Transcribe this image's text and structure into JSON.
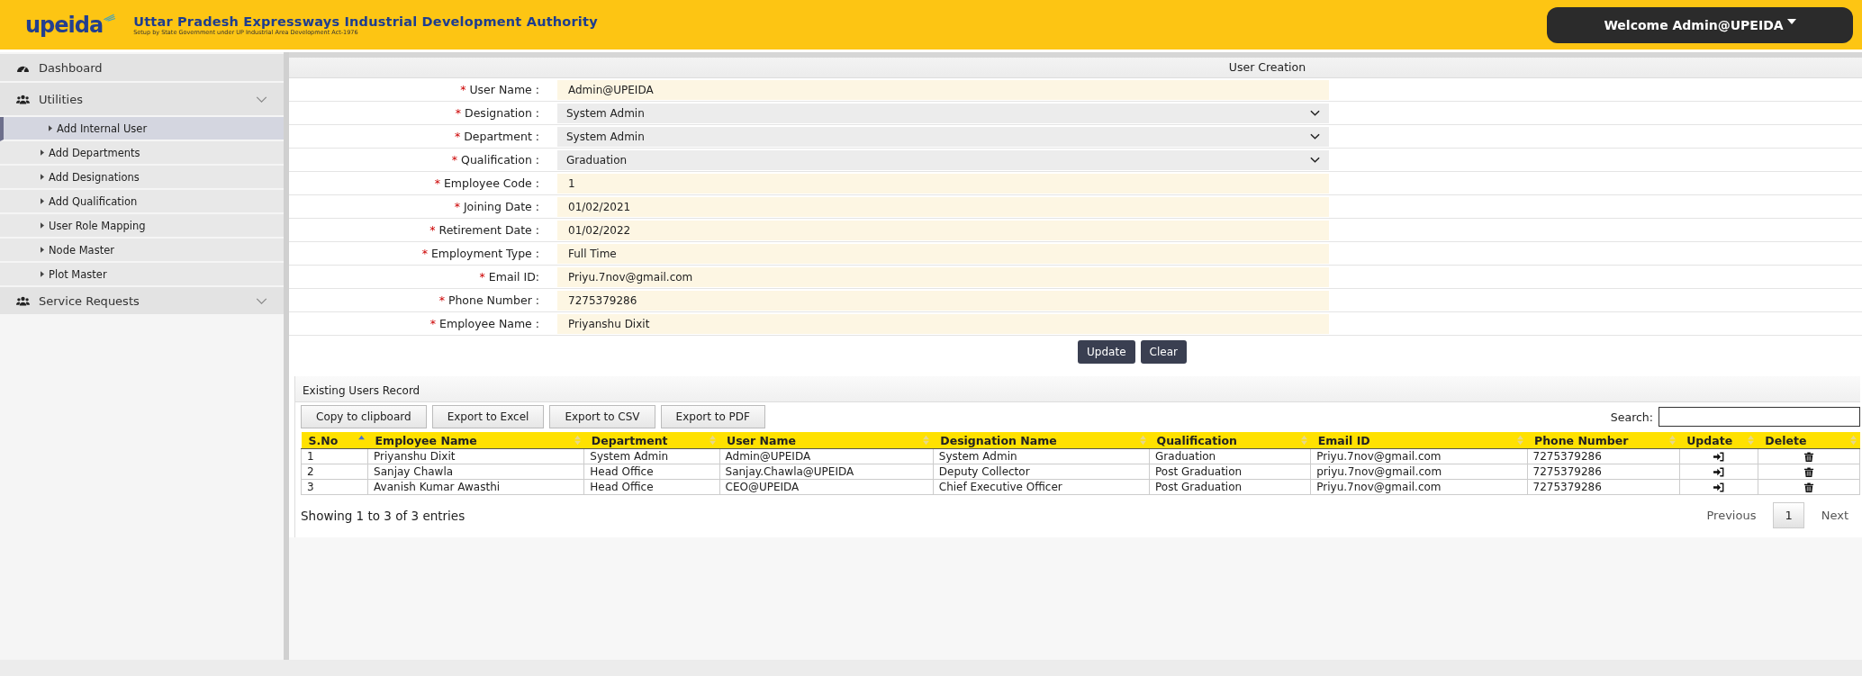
{
  "header": {
    "logo_text": "upeida",
    "title": "Uttar Pradesh Expressways Industrial Development Authority",
    "subtitle": "Setup by State Government under UP Industrial Area Development Act-1976",
    "user_menu": "Welcome Admin@UPEIDA"
  },
  "sidebar": {
    "items": [
      {
        "label": "Dashboard",
        "kind": "link"
      },
      {
        "label": "Utilities",
        "kind": "group",
        "children": [
          {
            "label": "Add Internal User",
            "selected": true
          },
          {
            "label": "Add Departments",
            "selected": false
          },
          {
            "label": "Add Designations",
            "selected": false
          },
          {
            "label": "Add Qualification",
            "selected": false
          },
          {
            "label": "User Role Mapping",
            "selected": false
          },
          {
            "label": "Node Master",
            "selected": false
          },
          {
            "label": "Plot Master",
            "selected": false
          }
        ]
      },
      {
        "label": "Service Requests",
        "kind": "group"
      }
    ]
  },
  "form": {
    "title": "User Creation",
    "required_mark": "*",
    "fields": [
      {
        "label": "User Name :",
        "kind": "text",
        "value": "Admin@UPEIDA"
      },
      {
        "label": "Designation :",
        "kind": "select",
        "value": "System Admin"
      },
      {
        "label": "Department :",
        "kind": "select",
        "value": "System Admin"
      },
      {
        "label": "Qualification :",
        "kind": "select",
        "value": "Graduation"
      },
      {
        "label": "Employee Code :",
        "kind": "text",
        "value": "1"
      },
      {
        "label": "Joining Date :",
        "kind": "text",
        "value": "01/02/2021"
      },
      {
        "label": "Retirement Date :",
        "kind": "text",
        "value": "01/02/2022"
      },
      {
        "label": "Employment Type :",
        "kind": "text",
        "value": "Full Time"
      },
      {
        "label": "Email ID:",
        "kind": "text",
        "value": "Priyu.7nov@gmail.com"
      },
      {
        "label": "Phone Number :",
        "kind": "text",
        "value": "7275379286"
      },
      {
        "label": "Employee Name :",
        "kind": "text",
        "value": "Priyanshu Dixit"
      }
    ],
    "buttons": [
      "Update",
      "Clear"
    ]
  },
  "records": {
    "title": "Existing Users Record",
    "export_buttons": [
      "Copy to clipboard",
      "Export to Excel",
      "Export to CSV",
      "Export to PDF"
    ],
    "search_label": "Search:",
    "table": {
      "columns": [
        {
          "label": "S.No",
          "sorted": true
        },
        {
          "label": "Employee Name",
          "sorted": false
        },
        {
          "label": "Department",
          "sorted": false
        },
        {
          "label": "User Name",
          "sorted": false
        },
        {
          "label": "Designation Name",
          "sorted": false
        },
        {
          "label": "Qualification",
          "sorted": false
        },
        {
          "label": "Email ID",
          "sorted": false
        },
        {
          "label": "Phone Number",
          "sorted": false
        },
        {
          "label": "Update",
          "sorted": false
        },
        {
          "label": "Delete",
          "sorted": false
        }
      ],
      "rows": [
        [
          "1",
          "Priyanshu Dixit",
          "System Admin",
          "Admin@UPEIDA",
          "System Admin",
          "Graduation",
          "Priyu.7nov@gmail.com",
          "7275379286"
        ],
        [
          "2",
          "Sanjay Chawla",
          "Head Office",
          "Sanjay.Chawla@UPEIDA",
          "Deputy Collector",
          "Post Graduation",
          "priyu.7nov@gmail.com",
          "7275379286"
        ],
        [
          "3",
          "Avanish Kumar Awasthi",
          "Head Office",
          "CEO@UPEIDA",
          "Chief Executive Officer",
          "Post Graduation",
          "Priyu.7nov@gmail.com",
          "7275379286"
        ]
      ]
    },
    "info": "Showing 1 to 3 of 3 entries",
    "pagination": [
      {
        "label": "Previous",
        "selected": false
      },
      {
        "label": "1",
        "selected": true
      },
      {
        "label": "Next",
        "selected": false
      }
    ]
  }
}
